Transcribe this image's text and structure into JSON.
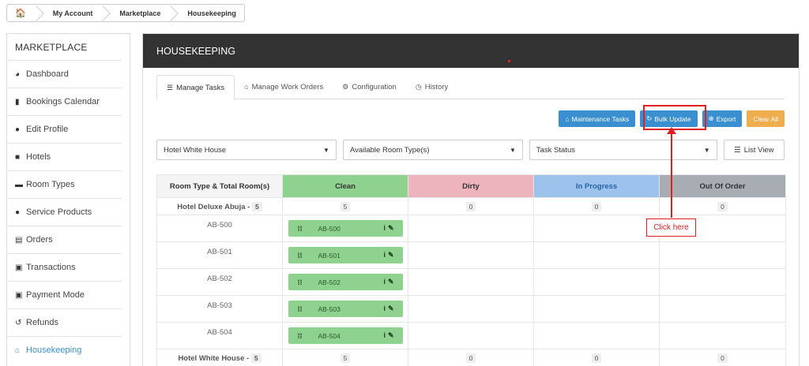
{
  "breadcrumb": {
    "items": [
      "My Account",
      "Marketplace",
      "Housekeeping"
    ]
  },
  "sidebar": {
    "title": "MARKETPLACE",
    "items": [
      {
        "label": "Dashboard",
        "icon": "dashboard-icon"
      },
      {
        "label": "Bookings Calendar",
        "icon": "bar-chart-icon"
      },
      {
        "label": "Edit Profile",
        "icon": "user-icon"
      },
      {
        "label": "Hotels",
        "icon": "building-icon"
      },
      {
        "label": "Room Types",
        "icon": "bed-icon"
      },
      {
        "label": "Service Products",
        "icon": "users-plus-icon"
      },
      {
        "label": "Orders",
        "icon": "credit-card-icon"
      },
      {
        "label": "Transactions",
        "icon": "money-icon"
      },
      {
        "label": "Payment Mode",
        "icon": "money-icon"
      },
      {
        "label": "Refunds",
        "icon": "undo-icon"
      },
      {
        "label": "Housekeeping",
        "icon": "home-icon",
        "active": true
      }
    ]
  },
  "panel": {
    "title": "HOUSEKEEPING"
  },
  "tabs": [
    {
      "label": "Manage Tasks",
      "icon": "list-icon",
      "active": true
    },
    {
      "label": "Manage Work Orders",
      "icon": "home-icon"
    },
    {
      "label": "Configuration",
      "icon": "cogs-icon"
    },
    {
      "label": "History",
      "icon": "clock-icon"
    }
  ],
  "actions": {
    "maintenance": "Maintenance Tasks",
    "bulk_update": "Bulk Update",
    "export": "Export",
    "clear_all": "Clear All"
  },
  "filters": {
    "hotel": "Hotel White House",
    "room_type": "Available Room Type(s)",
    "task_status": "Task Status",
    "list_view": "List View"
  },
  "table": {
    "headers": [
      "Room Type & Total Room(s)",
      "Clean",
      "Dirty",
      "In Progress",
      "Out Of Order"
    ],
    "groups": [
      {
        "hotel": "Hotel Deluxe Abuja -",
        "total": "5",
        "counts": [
          "5",
          "0",
          "0",
          "0"
        ],
        "rooms": [
          "AB-500",
          "AB-501",
          "AB-502",
          "AB-503",
          "AB-504"
        ]
      },
      {
        "hotel": "Hotel White House -",
        "total": "5",
        "counts": [
          "5",
          "0",
          "0",
          "0"
        ]
      }
    ]
  },
  "annotation": {
    "callout": "Click here"
  },
  "colors": {
    "header_bg": "#333333",
    "accent_blue": "#3a8fd0",
    "clean": "#8fd18f",
    "dirty": "#eeb4bd",
    "in_progress": "#9dc3ec",
    "out_of_order": "#a8acb3",
    "warning": "#f0ad4e",
    "annotation_red": "#e02020"
  }
}
